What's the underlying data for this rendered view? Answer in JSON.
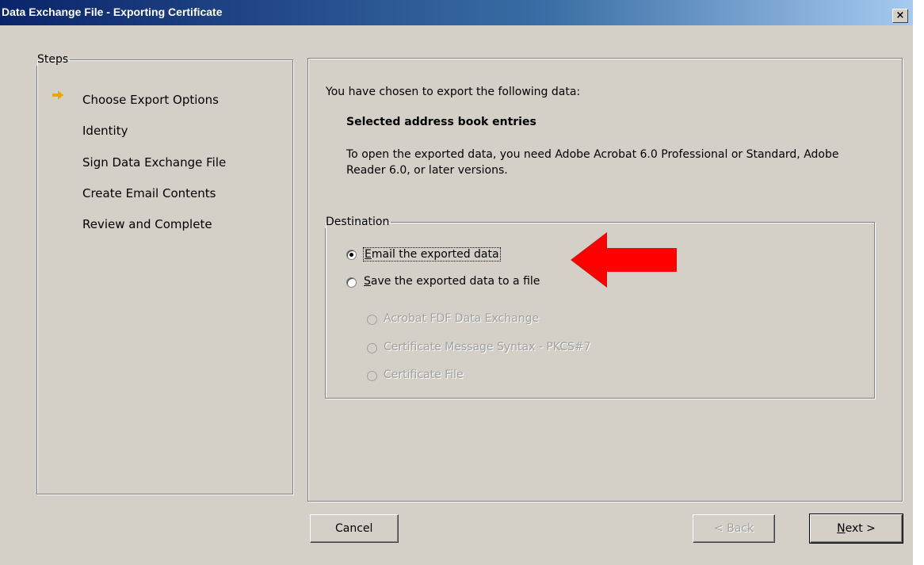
{
  "window": {
    "title": "Data Exchange File - Exporting Certificate",
    "close_label": "×"
  },
  "steps": {
    "legend": "Steps",
    "items": [
      {
        "label": "Choose Export Options",
        "current": true
      },
      {
        "label": "Identity",
        "current": false
      },
      {
        "label": "Sign Data Exchange File",
        "current": false
      },
      {
        "label": "Create Email Contents",
        "current": false
      },
      {
        "label": "Review and Complete",
        "current": false
      }
    ]
  },
  "main": {
    "intro": "You have chosen to export the following data:",
    "selection": "Selected address book entries",
    "requirement_line1": "To open the exported data, you need Adobe Acrobat 6.0 Professional or Standard, Adobe",
    "requirement_line2": "Reader 6.0, or later versions."
  },
  "destination": {
    "legend": "Destination",
    "email": {
      "prefix": "",
      "mnemonic": "E",
      "rest": "mail the exported data",
      "selected": true
    },
    "save": {
      "prefix": "",
      "mnemonic": "S",
      "rest": "ave the exported data to a file",
      "selected": false
    },
    "formats": [
      {
        "label": "Acrobat FDF Data Exchange"
      },
      {
        "label": "Certificate Message Syntax - PKCS#7"
      },
      {
        "label": "Certificate File"
      }
    ]
  },
  "buttons": {
    "cancel": "Cancel",
    "back": "< Back",
    "next_mnemonic": "N",
    "next_rest": "ext >"
  },
  "colors": {
    "dialog_bg": "#d4d0c8",
    "title_bar": "#0a246a",
    "step_arrow": "#e8a800",
    "annotation_arrow": "#ff0000",
    "disabled_text": "#a0a0a0"
  }
}
